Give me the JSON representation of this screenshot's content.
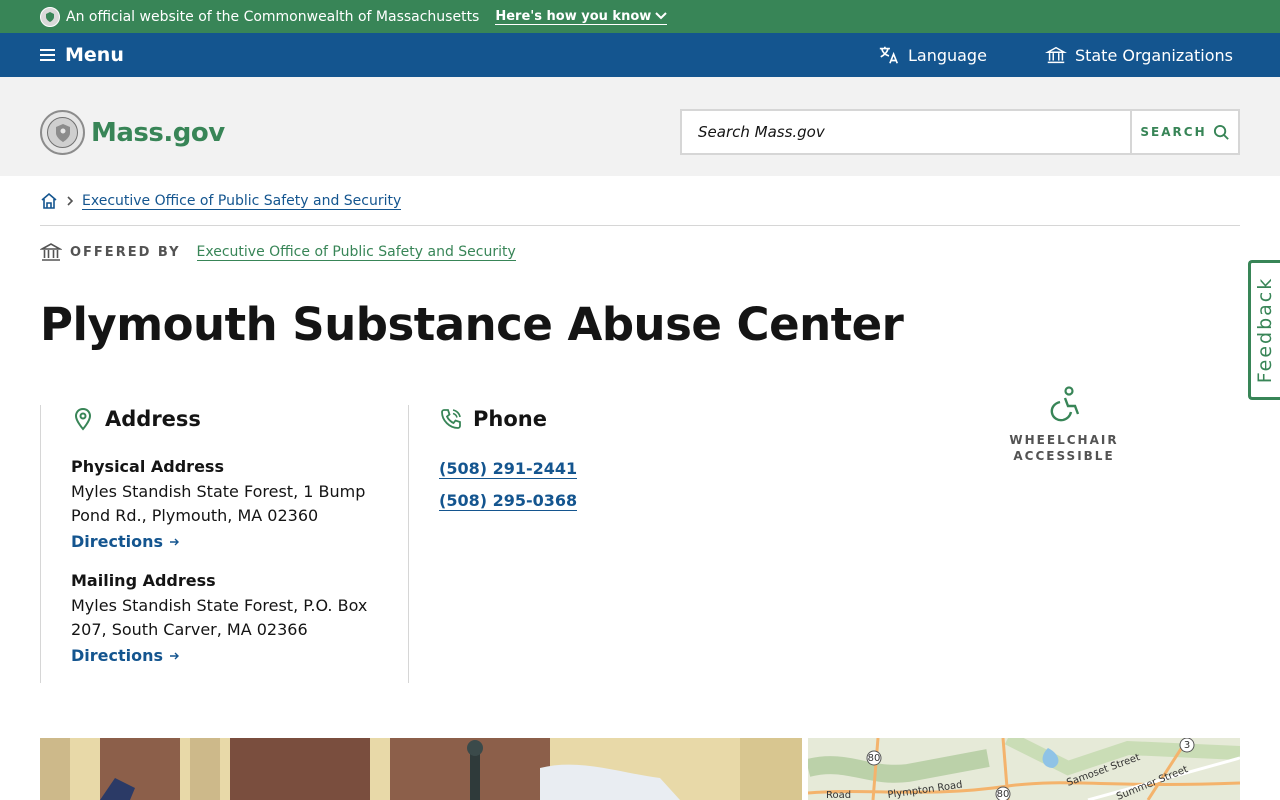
{
  "official_banner": {
    "text": "An official website of the Commonwealth of Massachusetts",
    "how_know": "Here's how you know"
  },
  "utility_nav": {
    "menu_label": "Menu",
    "language_label": "Language",
    "state_orgs_label": "State Organizations"
  },
  "header": {
    "logo_text": "Mass.gov",
    "search_placeholder": "Search Mass.gov",
    "search_button": "SEARCH"
  },
  "breadcrumb": {
    "items": [
      "Executive Office of Public Safety and Security"
    ]
  },
  "offered_by": {
    "label": "OFFERED BY",
    "org": "Executive Office of Public Safety and Security"
  },
  "page_title": "Plymouth Substance Abuse Center",
  "address": {
    "heading": "Address",
    "physical_label": "Physical Address",
    "physical_text": "Myles Standish State Forest, 1 Bump Pond Rd., Plymouth, MA 02360",
    "mailing_label": "Mailing Address",
    "mailing_text": "Myles Standish State Forest, P.O. Box 207, South Carver, MA 02366",
    "directions_label": "Directions"
  },
  "phone": {
    "heading": "Phone",
    "numbers": [
      "(508) 291-2441",
      "(508) 295-0368"
    ]
  },
  "accessibility": {
    "label_line1": "WHEELCHAIR",
    "label_line2": "ACCESSIBLE"
  },
  "feedback_label": "Feedback",
  "map": {
    "road_labels": [
      "Road",
      "Plympton Road",
      "Samoset Street",
      "Summer Street"
    ],
    "route_markers": [
      "80",
      "80",
      "3"
    ]
  },
  "colors": {
    "green": "#388557",
    "blue": "#14558f",
    "header_bg": "#f2f2f2"
  }
}
